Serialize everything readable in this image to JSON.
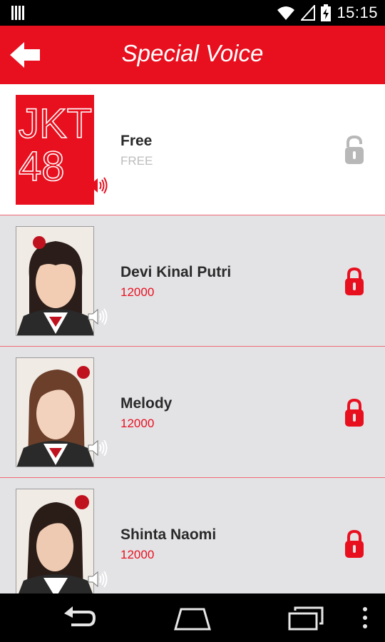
{
  "status_bar": {
    "time": "15:15",
    "icons": [
      "notification-icon",
      "wifi-icon",
      "signal-icon",
      "battery-charging-icon"
    ]
  },
  "app_bar": {
    "title": "Special Voice",
    "back_icon": "back-arrow-icon"
  },
  "logo_text": [
    "JKT",
    "48"
  ],
  "items": [
    {
      "name": "Free",
      "price": "FREE",
      "locked": false
    },
    {
      "name": "Devi Kinal Putri",
      "price": "12000",
      "locked": true
    },
    {
      "name": "Melody",
      "price": "12000",
      "locked": true
    },
    {
      "name": "Shinta Naomi",
      "price": "12000",
      "locked": true
    }
  ],
  "nav_bar": {
    "icons": [
      "back-icon",
      "home-icon",
      "recents-icon",
      "overflow-menu-icon"
    ]
  },
  "colors": {
    "brand_red": "#e8101f",
    "list_bg": "#e3e3e6",
    "lock_unlocked": "#b8b8b8"
  }
}
